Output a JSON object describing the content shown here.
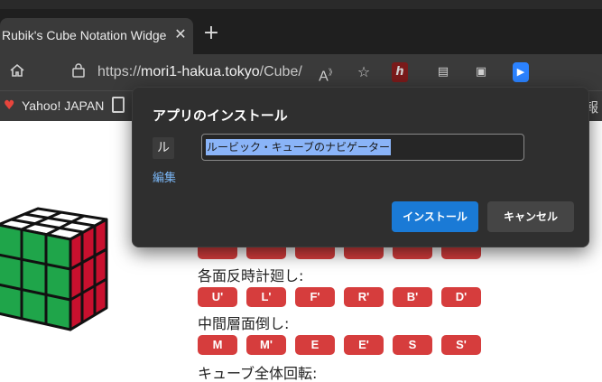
{
  "browser": {
    "tab_title": "Rubik's Cube Notation Widge",
    "tab_close": "✕",
    "new_tab": "+",
    "url_prefix": "https://",
    "url_host": "mori1-hakua.tokyo",
    "url_path": "/Cube/",
    "bookmark_label": "Yahoo! JAPAN",
    "bookmark_overflow": "報"
  },
  "page": {
    "section_counterclockwise": "各面反時計廻し:",
    "counterclockwise_buttons": [
      "U'",
      "L'",
      "F'",
      "R'",
      "B'",
      "D'"
    ],
    "section_middle": "中間層面倒し:",
    "middle_buttons": [
      "M",
      "M'",
      "E",
      "E'",
      "S",
      "S'"
    ],
    "section_rotation": "キューブ全体回転:"
  },
  "dialog": {
    "title": "アプリのインストール",
    "app_icon_text": "ル",
    "app_name_value": "ルービック・キューブのナビゲーター",
    "edit_link": "編集",
    "install_button": "インストール",
    "cancel_button": "キャンセル"
  },
  "colors": {
    "button_red": "#d63d3d",
    "install_blue": "#1a7ad6",
    "cube_green": "#1fa54a",
    "cube_red": "#c8102e",
    "cube_white": "#ffffff"
  }
}
